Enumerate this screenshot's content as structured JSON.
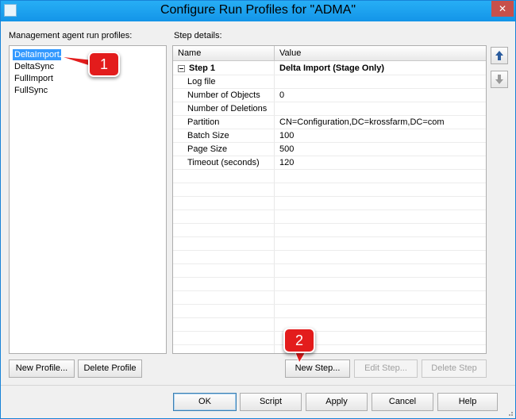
{
  "window": {
    "title": "Configure Run Profiles for \"ADMA\"",
    "close_glyph": "✕"
  },
  "profiles": {
    "label": "Management agent run profiles:",
    "items": [
      "DeltaImport",
      "DeltaSync",
      "FullImport",
      "FullSync"
    ],
    "selected": "DeltaImport",
    "new_button": "New Profile...",
    "delete_button": "Delete Profile"
  },
  "steps": {
    "label": "Step details:",
    "columns": [
      "Name",
      "Value"
    ],
    "rows": [
      {
        "name": "Step 1",
        "value": "Delta Import (Stage Only)"
      },
      {
        "name": "Log file",
        "value": ""
      },
      {
        "name": "Number of Objects",
        "value": "0"
      },
      {
        "name": "Number of Deletions",
        "value": ""
      },
      {
        "name": "Partition",
        "value": "CN=Configuration,DC=krossfarm,DC=com"
      },
      {
        "name": "Batch Size",
        "value": "100"
      },
      {
        "name": "Page Size",
        "value": "500"
      },
      {
        "name": "Timeout (seconds)",
        "value": "120"
      }
    ],
    "new_button": "New Step...",
    "edit_button": "Edit Step...",
    "delete_button": "Delete Step",
    "move_up_icon": "arrow-up-icon",
    "move_down_icon": "arrow-down-icon"
  },
  "dialog_buttons": {
    "ok": "OK",
    "script": "Script",
    "apply": "Apply",
    "cancel": "Cancel",
    "help": "Help"
  },
  "annotations": {
    "callout_1": "1",
    "callout_2": "2",
    "color": "#e31c1c"
  },
  "colors": {
    "titlebar": "#18a2f3",
    "selection": "#3399ff"
  }
}
